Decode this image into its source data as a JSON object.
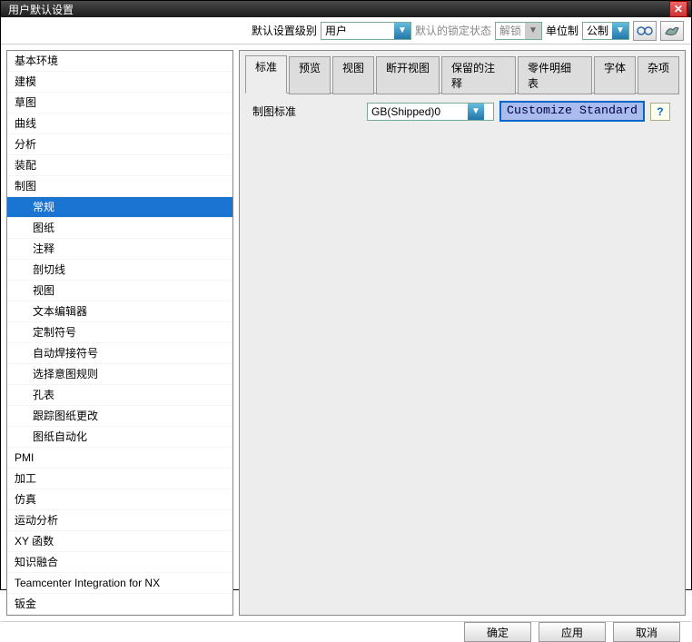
{
  "window": {
    "title": "用户默认设置"
  },
  "toolbar": {
    "level_label": "默认设置级别",
    "level_value": "用户",
    "lock_label": "默认的锁定状态",
    "lock_value": "解锁",
    "unit_label": "单位制",
    "unit_value": "公制"
  },
  "tree": {
    "items": [
      {
        "label": "基本环境",
        "level": 0
      },
      {
        "label": "建模",
        "level": 0
      },
      {
        "label": "草图",
        "level": 0
      },
      {
        "label": "曲线",
        "level": 0
      },
      {
        "label": "分析",
        "level": 0
      },
      {
        "label": "装配",
        "level": 0
      },
      {
        "label": "制图",
        "level": 0
      },
      {
        "label": "常规",
        "level": 1,
        "selected": true
      },
      {
        "label": "图纸",
        "level": 1
      },
      {
        "label": "注释",
        "level": 1
      },
      {
        "label": "剖切线",
        "level": 1
      },
      {
        "label": "视图",
        "level": 1
      },
      {
        "label": "文本编辑器",
        "level": 1
      },
      {
        "label": "定制符号",
        "level": 1
      },
      {
        "label": "自动焊接符号",
        "level": 1
      },
      {
        "label": "选择意图规则",
        "level": 1
      },
      {
        "label": "孔表",
        "level": 1
      },
      {
        "label": "跟踪图纸更改",
        "level": 1
      },
      {
        "label": "图纸自动化",
        "level": 1
      },
      {
        "label": "PMI",
        "level": 0
      },
      {
        "label": "加工",
        "level": 0
      },
      {
        "label": "仿真",
        "level": 0
      },
      {
        "label": "运动分析",
        "level": 0
      },
      {
        "label": "XY 函数",
        "level": 0
      },
      {
        "label": "知识融合",
        "level": 0
      },
      {
        "label": "Teamcenter Integration for NX",
        "level": 0
      },
      {
        "label": "钣金",
        "level": 0
      }
    ]
  },
  "tabs": {
    "items": [
      "标准",
      "预览",
      "视图",
      "断开视图",
      "保留的注释",
      "零件明细表",
      "字体",
      "杂项"
    ],
    "active": 0
  },
  "content": {
    "standard_label": "制图标准",
    "standard_value": "GB(Shipped)0",
    "customize_label": "Customize Standard"
  },
  "footer": {
    "ok": "确定",
    "apply": "应用",
    "cancel": "取消"
  }
}
